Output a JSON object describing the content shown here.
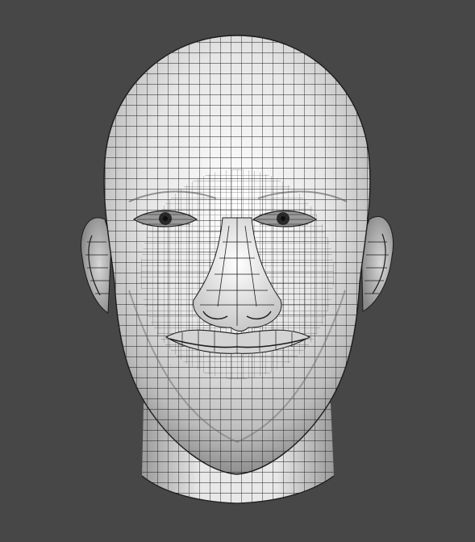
{
  "viewport": {
    "background": "#474747",
    "subject": "head-wireframe-mesh"
  },
  "mesh": {
    "surface_color": "#f2f2f2",
    "shade_color": "#8a8a8a",
    "wire_color": "#1c1c1c"
  }
}
